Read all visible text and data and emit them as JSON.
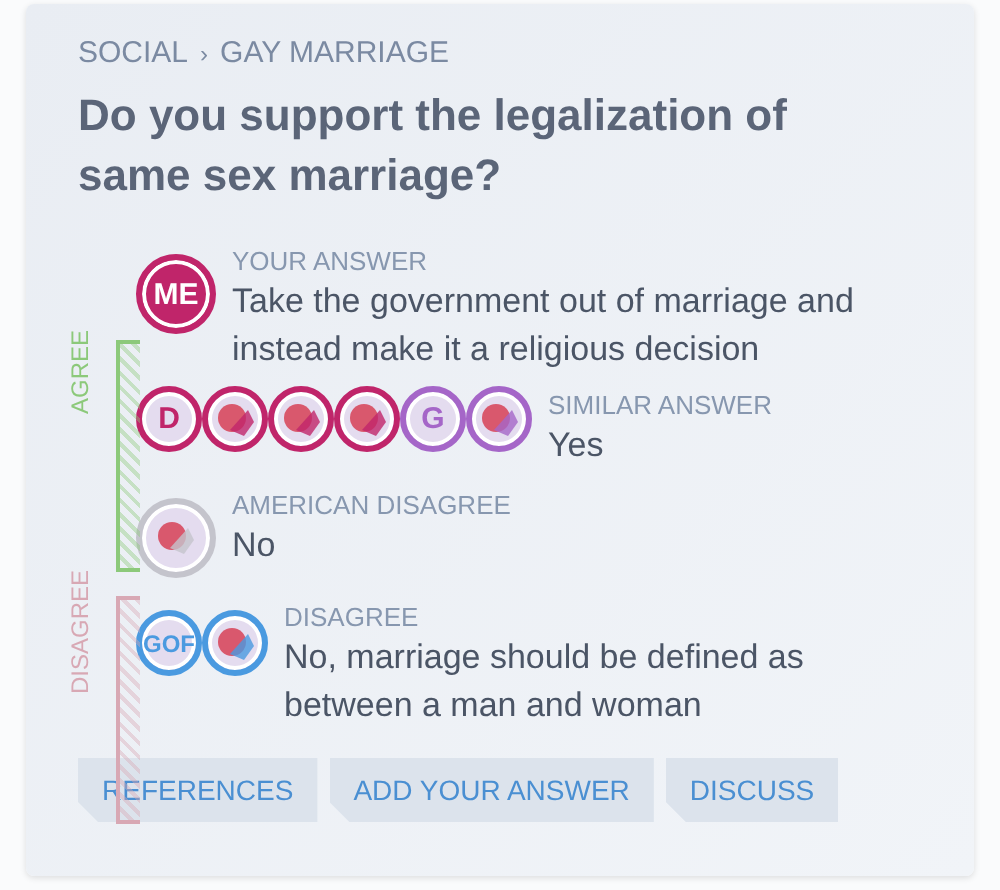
{
  "breadcrumb": {
    "category": "SOCIAL",
    "separator": "›",
    "topic": "GAY MARRIAGE"
  },
  "question": "Do you support the legalization of same sex marriage?",
  "scale": [
    {
      "label": "AGREE",
      "color": "#8cc97a"
    },
    {
      "label": "DISAGREE",
      "color": "#d8a8b4"
    }
  ],
  "answers": [
    {
      "kind": "you",
      "label": "YOUR ANSWER",
      "text": "Take the government out of marriage and instead make it a religious decision",
      "avatars": [
        {
          "kind": "letters",
          "text": "ME",
          "color": "#c0256a"
        }
      ]
    },
    {
      "kind": "similar",
      "label": "SIMILAR ANSWER",
      "text": "Yes",
      "avatars": [
        {
          "kind": "letters",
          "text": "D",
          "color": "#c0256a"
        },
        {
          "kind": "logo",
          "color": "#c0256a"
        },
        {
          "kind": "logo",
          "color": "#c0256a"
        },
        {
          "kind": "logo",
          "color": "#c0256a"
        },
        {
          "kind": "letters",
          "text": "G",
          "color": "#a566c8"
        },
        {
          "kind": "logo",
          "color": "#a566c8"
        }
      ]
    },
    {
      "kind": "opinion",
      "label": "AMERICAN DISAGREE",
      "text": "No",
      "avatars": [
        {
          "kind": "logo",
          "color": "#c4c4cc"
        }
      ]
    },
    {
      "kind": "opinion",
      "label": "DISAGREE",
      "text": "No, marriage should be defined as between a man and woman",
      "avatars": [
        {
          "kind": "letters",
          "text": "GOF",
          "color": "#4a9ae0"
        },
        {
          "kind": "logo",
          "color": "#4a9ae0"
        }
      ]
    }
  ],
  "actions": [
    "REFERENCES",
    "ADD YOUR ANSWER",
    "DISCUSS"
  ]
}
